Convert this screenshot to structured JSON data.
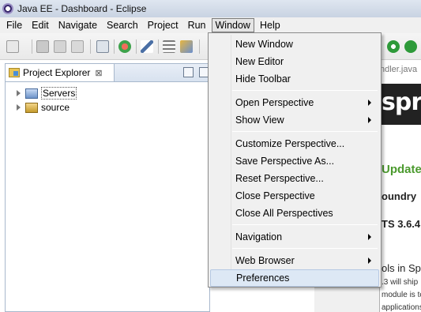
{
  "window": {
    "title": "Java EE - Dashboard - Eclipse"
  },
  "menubar": {
    "items": [
      {
        "label": "File"
      },
      {
        "label": "Edit"
      },
      {
        "label": "Navigate"
      },
      {
        "label": "Search"
      },
      {
        "label": "Project"
      },
      {
        "label": "Run"
      },
      {
        "label": "Window"
      },
      {
        "label": "Help"
      }
    ]
  },
  "explorer": {
    "tab_label": "Project Explorer",
    "tab_close": "⊠",
    "tree": [
      {
        "label": "Servers"
      },
      {
        "label": "source"
      }
    ]
  },
  "window_menu": {
    "items": [
      {
        "label": "New Window",
        "submenu": false
      },
      {
        "label": "New Editor",
        "submenu": false
      },
      {
        "label": "Hide Toolbar",
        "submenu": false
      },
      {
        "label": "Open Perspective",
        "submenu": true
      },
      {
        "label": "Show View",
        "submenu": true
      },
      {
        "label": "Customize Perspective...",
        "submenu": false
      },
      {
        "label": "Save Perspective As...",
        "submenu": false
      },
      {
        "label": "Reset Perspective...",
        "submenu": false
      },
      {
        "label": "Close Perspective",
        "submenu": false
      },
      {
        "label": "Close All Perspectives",
        "submenu": false
      },
      {
        "label": "Navigation",
        "submenu": true
      },
      {
        "label": "Web Browser",
        "submenu": true
      },
      {
        "label": "Preferences",
        "submenu": false,
        "highlighted": true
      }
    ]
  },
  "editor": {
    "tab_label": "ndler.java",
    "banner_text": "spri",
    "update_heading": "Update",
    "foundry_heading": "oundry",
    "sts_heading": "TS 3.6.4",
    "tools_heading": "ols in Sp",
    "body_line_1": ".3 will ship",
    "body_line_2": "module is to try and imp",
    "body_line_3": "applications.To use ... A"
  },
  "colors": {
    "menu_highlight": "#dde8f5",
    "spring_green": "#4b9a2e",
    "banner_bg": "#222222"
  }
}
